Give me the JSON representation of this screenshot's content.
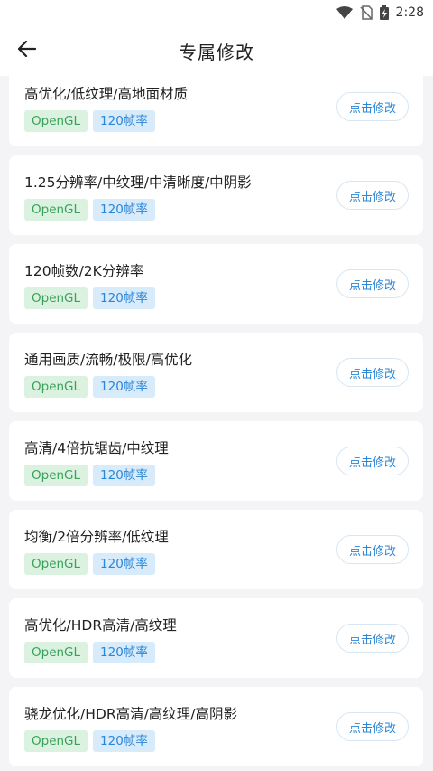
{
  "status_bar": {
    "time": "2:28",
    "icons": [
      "wifi-icon",
      "no-sim-icon",
      "battery-charging-icon"
    ]
  },
  "header": {
    "title": "专属修改",
    "back_icon": "arrow-left-icon"
  },
  "colors": {
    "tag_green_bg": "#dcf2e0",
    "tag_green_text": "#3aa15a",
    "tag_blue_bg": "#d7ebfb",
    "tag_blue_text": "#2c86d6"
  },
  "items": [
    {
      "title": "高优化/低纹理/高地面材质",
      "tag1": "OpenGL",
      "tag2": "120帧率",
      "button": "点击修改"
    },
    {
      "title": "1.25分辨率/中纹理/中清晰度/中阴影",
      "tag1": "OpenGL",
      "tag2": "120帧率",
      "button": "点击修改"
    },
    {
      "title": "120帧数/2K分辨率",
      "tag1": "OpenGL",
      "tag2": "120帧率",
      "button": "点击修改"
    },
    {
      "title": "通用画质/流畅/极限/高优化",
      "tag1": "OpenGL",
      "tag2": "120帧率",
      "button": "点击修改"
    },
    {
      "title": "高清/4倍抗锯齿/中纹理",
      "tag1": "OpenGL",
      "tag2": "120帧率",
      "button": "点击修改"
    },
    {
      "title": "均衡/2倍分辨率/低纹理",
      "tag1": "OpenGL",
      "tag2": "120帧率",
      "button": "点击修改"
    },
    {
      "title": "高优化/HDR高清/高纹理",
      "tag1": "OpenGL",
      "tag2": "120帧率",
      "button": "点击修改"
    },
    {
      "title": "骁龙优化/HDR高清/高纹理/高阴影",
      "tag1": "OpenGL",
      "tag2": "120帧率",
      "button": "点击修改"
    }
  ]
}
